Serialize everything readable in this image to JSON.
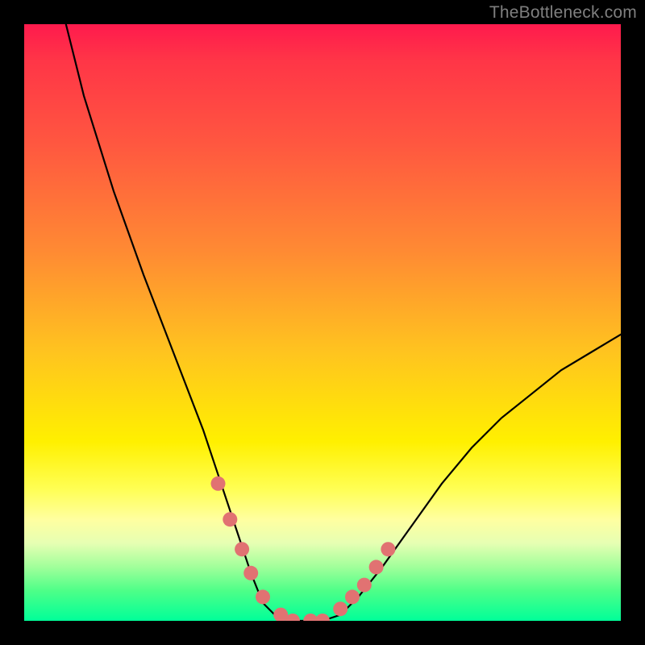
{
  "watermark": "TheBottleneck.com",
  "chart_data": {
    "type": "line",
    "title": "",
    "xlabel": "",
    "ylabel": "",
    "xlim": [
      0,
      100
    ],
    "ylim": [
      0,
      100
    ],
    "series": [
      {
        "name": "black-curve",
        "color": "#000000",
        "x": [
          7,
          10,
          15,
          20,
          25,
          30,
          33,
          36,
          38,
          40,
          42,
          45,
          48,
          50,
          53,
          56,
          60,
          65,
          70,
          75,
          80,
          85,
          90,
          95,
          100
        ],
        "y": [
          100,
          88,
          72,
          58,
          45,
          32,
          23,
          14,
          8,
          3,
          1,
          0,
          0,
          0,
          1,
          4,
          9,
          16,
          23,
          29,
          34,
          38,
          42,
          45,
          48
        ]
      },
      {
        "name": "pink-dots-left",
        "color": "#e17272",
        "x": [
          32.5,
          34.5,
          36.5,
          38,
          40,
          43,
          45,
          48,
          50
        ],
        "y": [
          23,
          17,
          12,
          8,
          4,
          1,
          0,
          0,
          0
        ]
      },
      {
        "name": "pink-dots-right",
        "color": "#e17272",
        "x": [
          53,
          55,
          57,
          59,
          61
        ],
        "y": [
          2,
          4,
          6,
          9,
          12
        ]
      }
    ],
    "gradient_stops": [
      {
        "pos": 0,
        "color": "#ff1a4d"
      },
      {
        "pos": 20,
        "color": "#ff5740"
      },
      {
        "pos": 55,
        "color": "#ffc41f"
      },
      {
        "pos": 78,
        "color": "#ffff55"
      },
      {
        "pos": 95,
        "color": "#4dff88"
      },
      {
        "pos": 100,
        "color": "#00ff99"
      }
    ]
  }
}
